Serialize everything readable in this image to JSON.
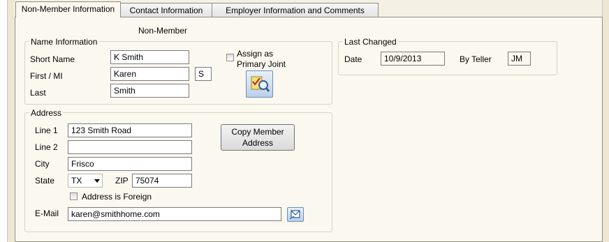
{
  "tabs": [
    {
      "label": "Non-Member Information",
      "active": true
    },
    {
      "label": "Contact Information",
      "active": false
    },
    {
      "label": "Employer Information and Comments",
      "active": false
    }
  ],
  "section_title": "Non-Member",
  "name_info": {
    "legend": "Name Information",
    "short_name_label": "Short Name",
    "short_name": "K Smith",
    "first_label": "First / MI",
    "first": "Karen",
    "mi": "S",
    "last_label": "Last",
    "last": "Smith",
    "assign_label_line1": "Assign as",
    "assign_label_line2": "Primary Joint",
    "assign_checked": false
  },
  "last_changed": {
    "legend": "Last Changed",
    "date_label": "Date",
    "date": "10/9/2013",
    "teller_label": "By Teller",
    "teller": "JM"
  },
  "address": {
    "legend": "Address",
    "line1_label": "Line 1",
    "line1": "123 Smith Road",
    "line2_label": "Line 2",
    "line2": "",
    "city_label": "City",
    "city": "Frisco",
    "state_label": "State",
    "state": "TX",
    "zip_label": "ZIP",
    "zip": "75074",
    "foreign_label": "Address is Foreign",
    "foreign_checked": false,
    "copy_button_line1": "Copy Member",
    "copy_button_line2": "Address",
    "email_label": "E-Mail",
    "email": "karen@smithhome.com"
  },
  "icons": {
    "assign_button_icon": "checklist-magnifier-icon",
    "email_button_icon": "email-send-icon",
    "dropdown_icon": "chevron-down-icon"
  }
}
